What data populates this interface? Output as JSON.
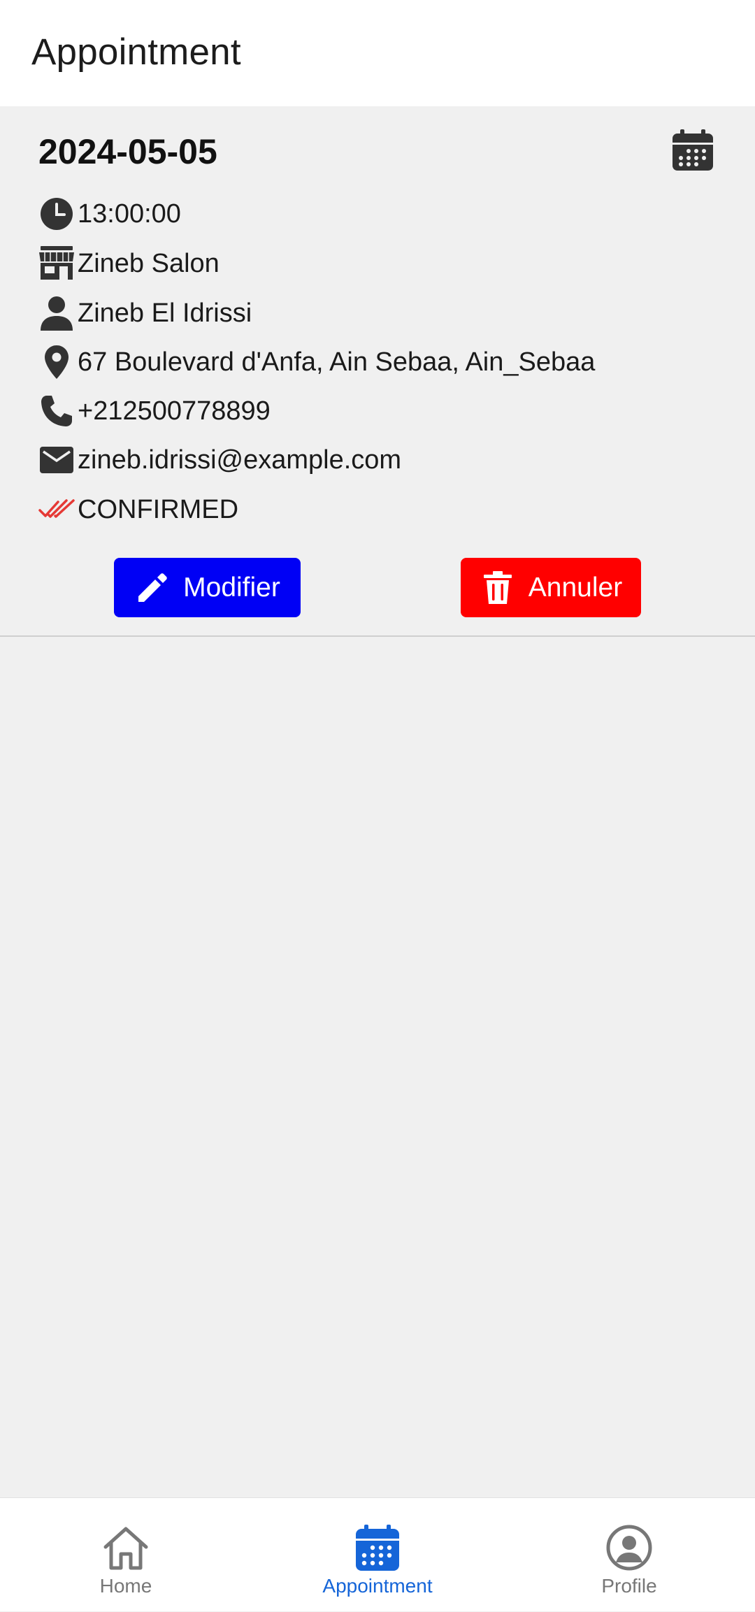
{
  "header": {
    "title": "Appointment"
  },
  "appointment": {
    "date": "2024-05-05",
    "time": "13:00:00",
    "salon": "Zineb Salon",
    "person": "Zineb El Idrissi",
    "address": "67 Boulevard d'Anfa, Ain Sebaa, Ain_Sebaa",
    "phone": "+212500778899",
    "email": "zineb.idrissi@example.com",
    "status": "CONFIRMED"
  },
  "actions": {
    "modify_label": "Modifier",
    "cancel_label": "Annuler"
  },
  "nav": {
    "items": [
      {
        "label": "Home",
        "icon": "home-icon"
      },
      {
        "label": "Appointment",
        "icon": "calendar-icon",
        "active": true
      },
      {
        "label": "Profile",
        "icon": "profile-icon"
      }
    ]
  },
  "colors": {
    "modify_button": "#0000f5",
    "cancel_button": "#ff0000",
    "status_check": "#e53935",
    "nav_active": "#1565d8",
    "nav_inactive": "#777777"
  }
}
